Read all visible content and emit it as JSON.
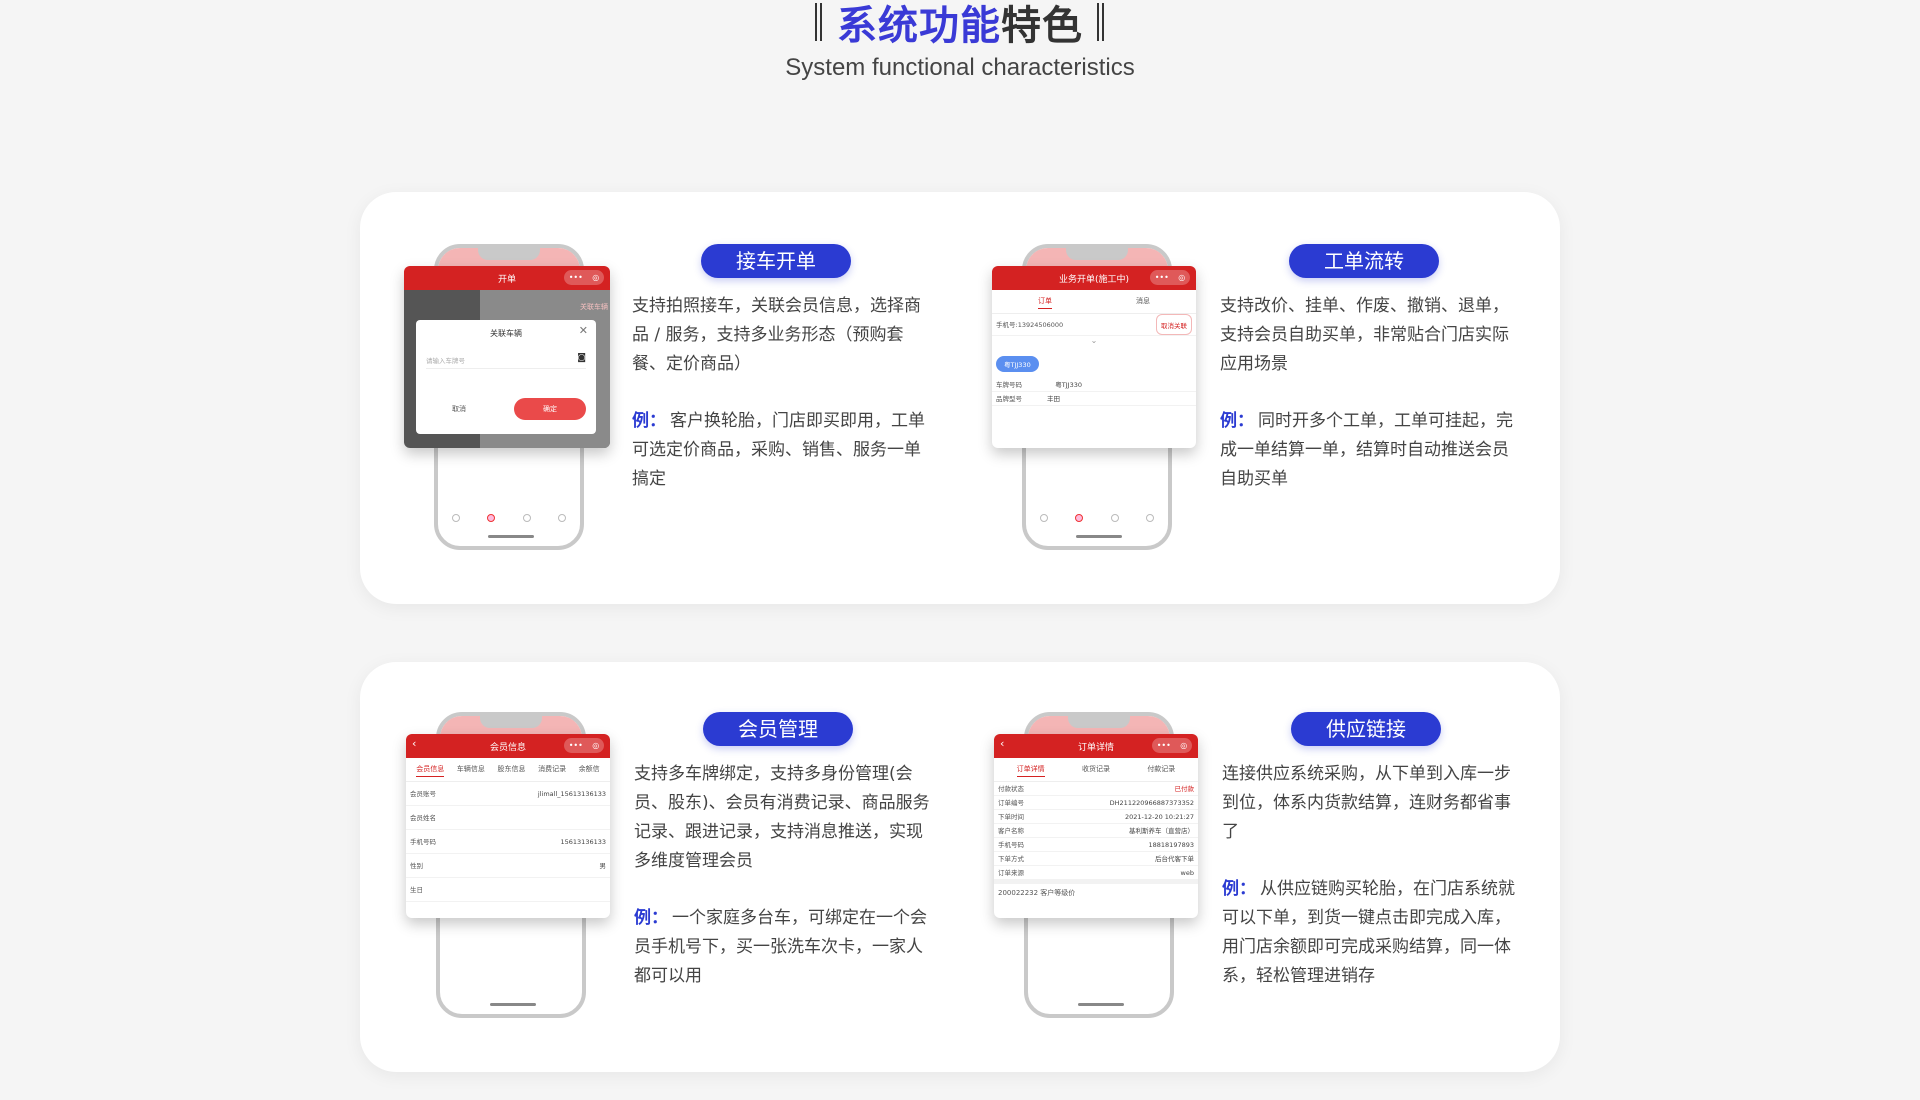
{
  "header": {
    "title_accent": "系统功能",
    "title_rest": "特色",
    "subtitle": "System functional characteristics"
  },
  "colors": {
    "accent": "#2b3bd2",
    "phone_red": "#d42222",
    "background": "#f5f5f5"
  },
  "features": [
    {
      "pill": "接车开单",
      "desc": "支持拍照接车，关联会员信息，选择商品 / 服务，支持多业务形态（预购套餐、定价商品）",
      "example_label": "例：",
      "example": "客户换轮胎，门店即买即用，工单可选定价商品，采购、销售、服务一单搞定",
      "screen": {
        "title": "开单",
        "modal_title": "关联车辆",
        "modal_placeholder": "请输入车牌号",
        "cancel": "取消",
        "confirm": "确定",
        "bg_tag": "关联车辆",
        "close_icon": "close-icon",
        "camera_icon": "camera-icon"
      }
    },
    {
      "pill": "工单流转",
      "desc": "支持改价、挂单、作废、撤销、退单，支持会员自助买单，非常贴合门店实际应用场景",
      "example_label": "例：",
      "example": "同时开多个工单，工单可挂起，完成一单结算一单，结算时自动推送会员自助买单",
      "screen": {
        "title": "业务开单(施工中)",
        "tab_1": "订单",
        "tab_2": "消息",
        "phone_label": "手机号:13924506000",
        "unlink": "取消关联",
        "plate_chip": "粤TJJ330",
        "plate_key": "车牌号码",
        "plate_val": "粤TJJ330",
        "brand_key": "品牌型号",
        "brand_val": "丰田"
      }
    },
    {
      "pill": "会员管理",
      "desc": "支持多车牌绑定，支持多身份管理(会员、股东)、会员有消费记录、商品服务记录、跟进记录，支持消息推送，实现多维度管理会员",
      "example_label": "例：",
      "example": "一个家庭多台车，可绑定在一个会员手机号下，买一张洗车次卡，一家人都可以用",
      "screen": {
        "title": "会员信息",
        "tabs": [
          "会员信息",
          "车辆信息",
          "股东信息",
          "消费记录",
          "余额信"
        ],
        "rows": [
          {
            "k": "会员账号",
            "v": "jlimall_15613136133"
          },
          {
            "k": "会员姓名",
            "v": ""
          },
          {
            "k": "手机号码",
            "v": "15613136133"
          },
          {
            "k": "性别",
            "v": "男"
          },
          {
            "k": "生日",
            "v": ""
          }
        ]
      }
    },
    {
      "pill": "供应链接",
      "desc": "连接供应系统采购，从下单到入库一步到位，体系内货款结算，连财务都省事了",
      "example_label": "例：",
      "example": "从供应链购买轮胎，在门店系统就可以下单，到货一键点击即完成入库，用门店余额即可完成采购结算，同一体系，轻松管理进销存",
      "screen": {
        "title": "订单详情",
        "tabs": [
          "订单详情",
          "收货记录",
          "付款记录"
        ],
        "rows": [
          {
            "k": "付款状态",
            "v": "已付款",
            "red": true
          },
          {
            "k": "订单编号",
            "v": "DH211220966887373352",
            "red": false
          },
          {
            "k": "下单时间",
            "v": "2021-12-20 10:21:27",
            "red": false
          },
          {
            "k": "客户名称",
            "v": "基利斯养车（直营店）",
            "red": false
          },
          {
            "k": "手机号码",
            "v": "18818197893",
            "red": false
          },
          {
            "k": "下单方式",
            "v": "后台代客下单",
            "red": false
          },
          {
            "k": "订单来源",
            "v": "web",
            "red": false
          }
        ],
        "footer": "200022232 客户等级价"
      }
    }
  ]
}
